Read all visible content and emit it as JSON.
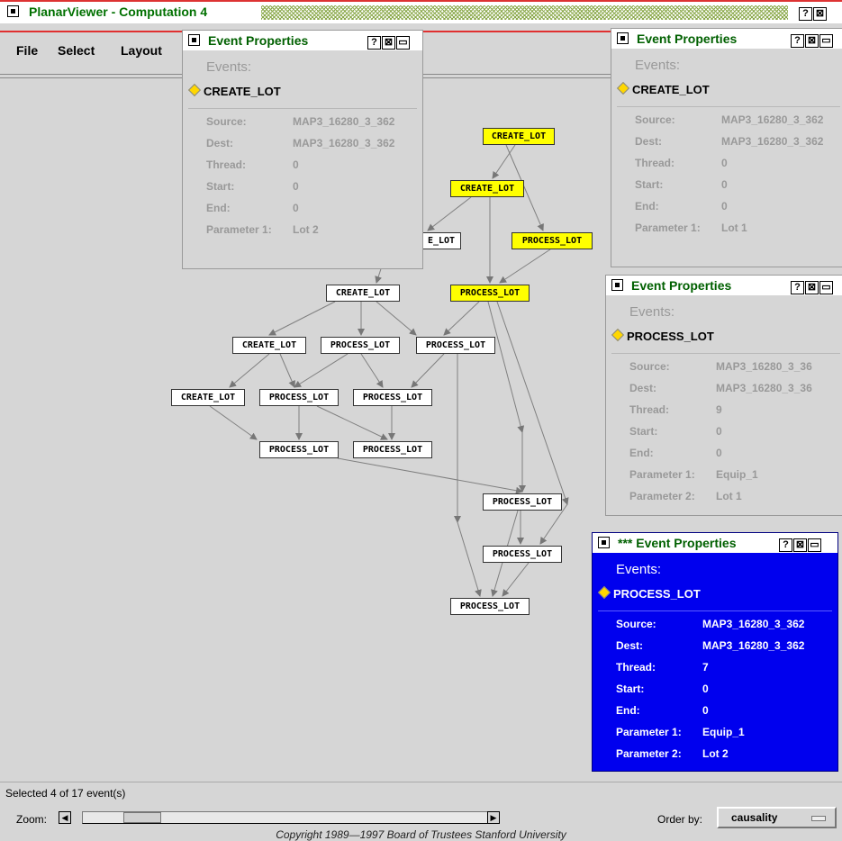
{
  "window": {
    "title": "PlanarViewer - Computation 4"
  },
  "menu": {
    "file": "File",
    "select": "Select",
    "layout": "Layout"
  },
  "graph": {
    "nodes": [
      {
        "label": "CREATE_LOT",
        "selected": true
      },
      {
        "label": "CREATE_LOT",
        "selected": true
      },
      {
        "label": "E_LOT",
        "selected": false
      },
      {
        "label": "PROCESS_LOT",
        "selected": true
      },
      {
        "label": "PROCESS_LOT",
        "selected": true
      },
      {
        "label": "CREATE_LOT",
        "selected": false
      },
      {
        "label": "CREATE_LOT",
        "selected": false
      },
      {
        "label": "PROCESS_LOT",
        "selected": false
      },
      {
        "label": "PROCESS_LOT",
        "selected": false
      },
      {
        "label": "CREATE_LOT",
        "selected": false
      },
      {
        "label": "PROCESS_LOT",
        "selected": false
      },
      {
        "label": "PROCESS_LOT",
        "selected": false
      },
      {
        "label": "PROCESS_LOT",
        "selected": false
      },
      {
        "label": "PROCESS_LOT",
        "selected": false
      },
      {
        "label": "PROCESS_LOT",
        "selected": false
      },
      {
        "label": "PROCESS_LOT",
        "selected": false
      },
      {
        "label": "PROCESS_LOT",
        "selected": false
      }
    ]
  },
  "panel_title": "Event Properties",
  "panel_title_active": "*** Event Properties",
  "panels": [
    {
      "events_label": "Events:",
      "event": "CREATE_LOT",
      "fields": [
        {
          "label": "Source:",
          "value": "MAP3_16280_3_362"
        },
        {
          "label": "Dest:",
          "value": "MAP3_16280_3_362"
        },
        {
          "label": "Thread:",
          "value": "0"
        },
        {
          "label": "Start:",
          "value": "0"
        },
        {
          "label": "End:",
          "value": "0"
        },
        {
          "label": "Parameter 1:",
          "value": "Lot 2"
        }
      ]
    },
    {
      "events_label": "Events:",
      "event": "CREATE_LOT",
      "fields": [
        {
          "label": "Source:",
          "value": "MAP3_16280_3_362"
        },
        {
          "label": "Dest:",
          "value": "MAP3_16280_3_362"
        },
        {
          "label": "Thread:",
          "value": "0"
        },
        {
          "label": "Start:",
          "value": "0"
        },
        {
          "label": "End:",
          "value": "0"
        },
        {
          "label": "Parameter 1:",
          "value": "Lot 1"
        }
      ]
    },
    {
      "events_label": "Events:",
      "event": "PROCESS_LOT",
      "fields": [
        {
          "label": "Source:",
          "value": "MAP3_16280_3_36"
        },
        {
          "label": "Dest:",
          "value": "MAP3_16280_3_36"
        },
        {
          "label": "Thread:",
          "value": "9"
        },
        {
          "label": "Start:",
          "value": "0"
        },
        {
          "label": "End:",
          "value": "0"
        },
        {
          "label": "Parameter 1:",
          "value": "Equip_1"
        },
        {
          "label": "Parameter 2:",
          "value": "Lot 1"
        }
      ]
    },
    {
      "events_label": "Events:",
      "event": "PROCESS_LOT",
      "fields": [
        {
          "label": "Source:",
          "value": "MAP3_16280_3_362"
        },
        {
          "label": "Dest:",
          "value": "MAP3_16280_3_362"
        },
        {
          "label": "Thread:",
          "value": "7"
        },
        {
          "label": "Start:",
          "value": "0"
        },
        {
          "label": "End:",
          "value": "0"
        },
        {
          "label": "Parameter 1:",
          "value": "Equip_1"
        },
        {
          "label": "Parameter 2:",
          "value": "Lot 2"
        }
      ]
    }
  ],
  "status": {
    "selected_text": "Selected 4 of 17 event(s)",
    "zoom_label": "Zoom:",
    "order_label": "Order by:",
    "order_value": "causality"
  },
  "copyright": "Copyright 1989—1997  Board of Trustees  Stanford University",
  "colors": {
    "selected_node": "#ffff00",
    "active_panel": "#0000ee",
    "title_text": "#007000",
    "title_rule": "#e03030"
  }
}
